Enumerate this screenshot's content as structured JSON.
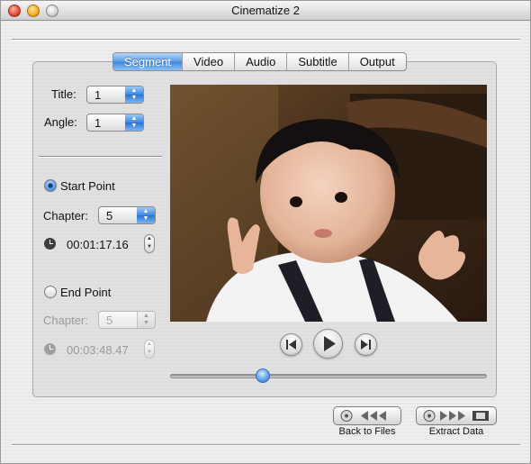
{
  "window": {
    "title": "Cinematize 2"
  },
  "tabs": [
    "Segment",
    "Video",
    "Audio",
    "Subtitle",
    "Output"
  ],
  "segment": {
    "title_label": "Title:",
    "title_value": "1",
    "angle_label": "Angle:",
    "angle_value": "1",
    "start": {
      "label": "Start Point",
      "selected": true,
      "chapter_label": "Chapter:",
      "chapter_value": "5",
      "time": "00:01:17.16"
    },
    "end": {
      "label": "End Point",
      "selected": false,
      "chapter_label": "Chapter:",
      "chapter_value": "5",
      "time": "00:03:48.47"
    }
  },
  "player": {
    "preview_subject": "baby-photo",
    "position_fraction": 0.28
  },
  "actions": {
    "back_label": "Back to Files",
    "extract_label": "Extract Data"
  },
  "colors": {
    "accent": "#3b86df"
  }
}
